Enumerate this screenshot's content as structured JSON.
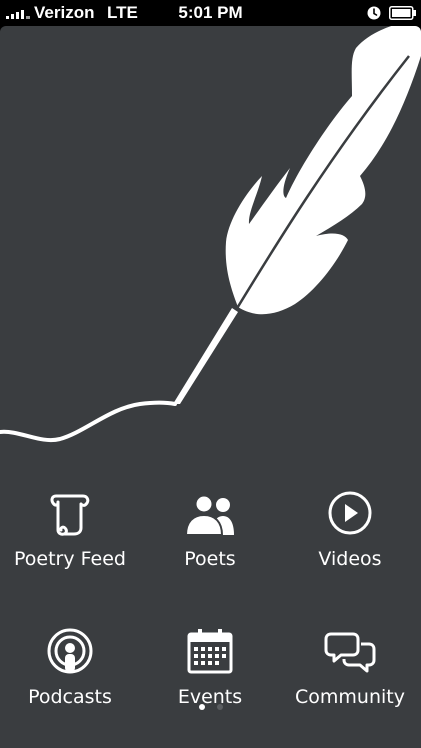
{
  "status_bar": {
    "carrier": "Verizon",
    "network": "LTE",
    "time": "5:01 PM",
    "icons": [
      "signal-bars-icon",
      "alarm-icon",
      "battery-icon"
    ]
  },
  "colors": {
    "background": "#3a3d40",
    "foreground": "#ffffff",
    "status_bar": "#000000"
  },
  "menu": [
    {
      "label": "Poetry Feed",
      "icon": "scroll-icon"
    },
    {
      "label": "Poets",
      "icon": "people-icon"
    },
    {
      "label": "Videos",
      "icon": "play-icon"
    },
    {
      "label": "Podcasts",
      "icon": "podcast-icon"
    },
    {
      "label": "Events",
      "icon": "calendar-icon"
    },
    {
      "label": "Community",
      "icon": "chat-bubbles-icon"
    }
  ],
  "pager": {
    "pages": 2,
    "current": 1
  }
}
